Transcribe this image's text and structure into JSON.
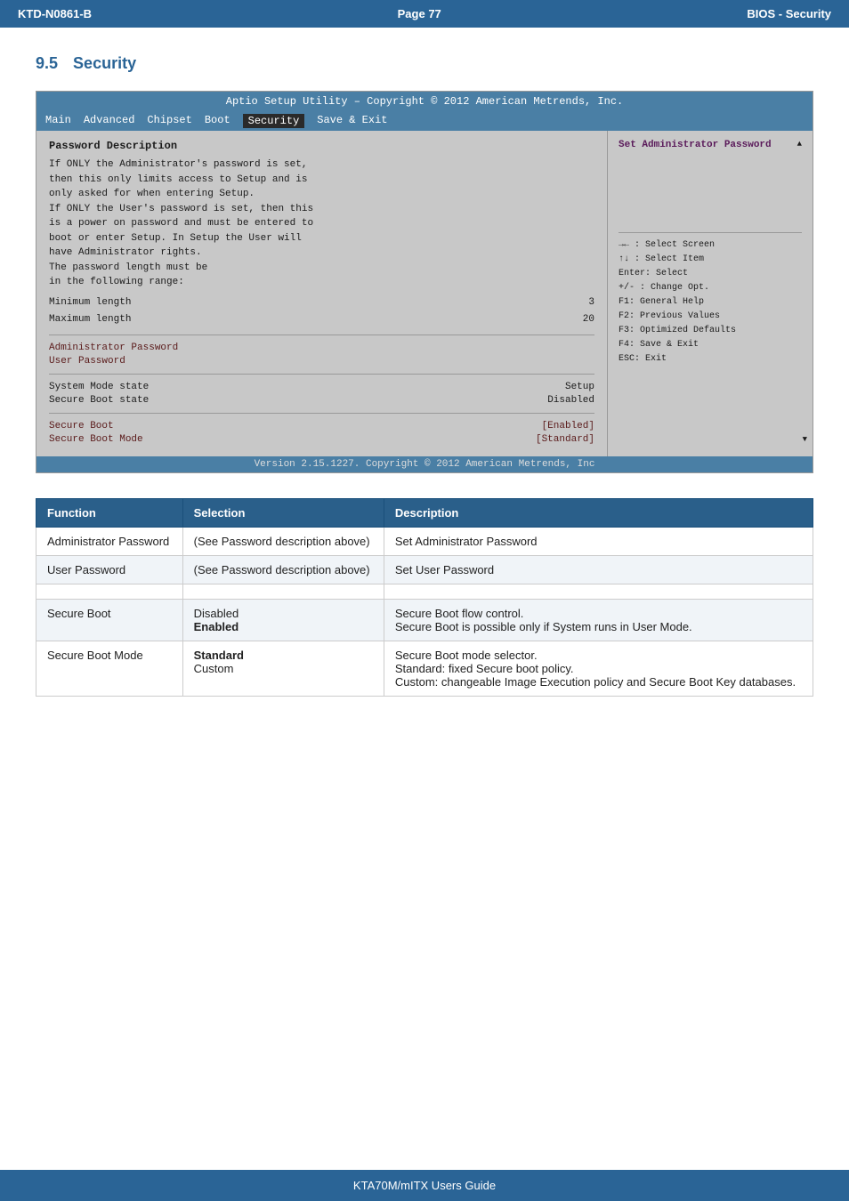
{
  "header": {
    "left": "KTD-N0861-B",
    "center": "Page 77",
    "right": "BIOS  - Security"
  },
  "section": {
    "number": "9.5",
    "title": "Security"
  },
  "bios": {
    "titlebar": "Aptio Setup Utility  –  Copyright © 2012 American Metrends, Inc.",
    "menu": {
      "items": [
        "Main",
        "Advanced",
        "Chipset",
        "Boot",
        "Security",
        "Save & Exit"
      ],
      "active": "Security"
    },
    "left": {
      "desc_title": "Password Description",
      "desc_lines": [
        "If ONLY the Administrator's password is set,",
        "then this only limits access to Setup and is",
        "only asked for when entering Setup.",
        "If ONLY the User's password is set, then this",
        "is a power on password and must be entered to",
        "boot or enter Setup. In Setup the User will",
        "have Administrator rights.",
        "The password length must be",
        "in the following range:"
      ],
      "min_label": "Minimum length",
      "min_value": "3",
      "max_label": "Maximum length",
      "max_value": "20",
      "items": [
        {
          "label": "Administrator Password",
          "value": "",
          "colored": true
        },
        {
          "label": "User Password",
          "value": "",
          "colored": true
        },
        {
          "label": "System Mode state",
          "value": "Setup",
          "colored": false
        },
        {
          "label": "Secure Boot state",
          "value": "Disabled",
          "colored": false
        },
        {
          "label": "Secure Boot",
          "value": "[Enabled]",
          "colored": true
        },
        {
          "label": "Secure Boot Mode",
          "value": "[Standard]",
          "colored": true
        }
      ]
    },
    "right": {
      "top_text": "Set Administrator Password",
      "help": {
        "select_screen": "→← : Select Screen",
        "select_item": "↑↓ : Select Item",
        "enter": "Enter: Select",
        "change": "+/- : Change Opt.",
        "f1": "F1: General Help",
        "f2": "F2: Previous Values",
        "f3": "F3: Optimized Defaults",
        "f4": "F4: Save & Exit",
        "esc": "ESC: Exit"
      }
    },
    "footer": "Version 2.15.1227. Copyright © 2012 American Metrends, Inc"
  },
  "table": {
    "headers": [
      "Function",
      "Selection",
      "Description"
    ],
    "rows": [
      {
        "function": "Administrator Password",
        "selection": "(See Password\ndescription above)",
        "description": "Set Administrator Password",
        "bold_selection": false
      },
      {
        "function": "User Password",
        "selection": "(See Password\ndescription above)",
        "description": "Set User Password",
        "bold_selection": false
      },
      {
        "function": "",
        "selection": "",
        "description": "",
        "bold_selection": false
      },
      {
        "function": "Secure Boot",
        "selection": "Disabled\nEnabled",
        "description": "Secure Boot flow control.\nSecure Boot is possible only if System runs in\nUser Mode.",
        "bold_selection": true,
        "bold_line": "Enabled"
      },
      {
        "function": "Secure Boot Mode",
        "selection": "Standard\nCustom",
        "description": "Secure Boot mode selector.\nStandard: fixed Secure boot policy.\nCustom: changeable Image Execution policy and\nSecure Boot Key databases.",
        "bold_selection": true,
        "bold_line": "Standard"
      }
    ]
  },
  "footer": {
    "text": "KTA70M/mITX Users Guide"
  }
}
